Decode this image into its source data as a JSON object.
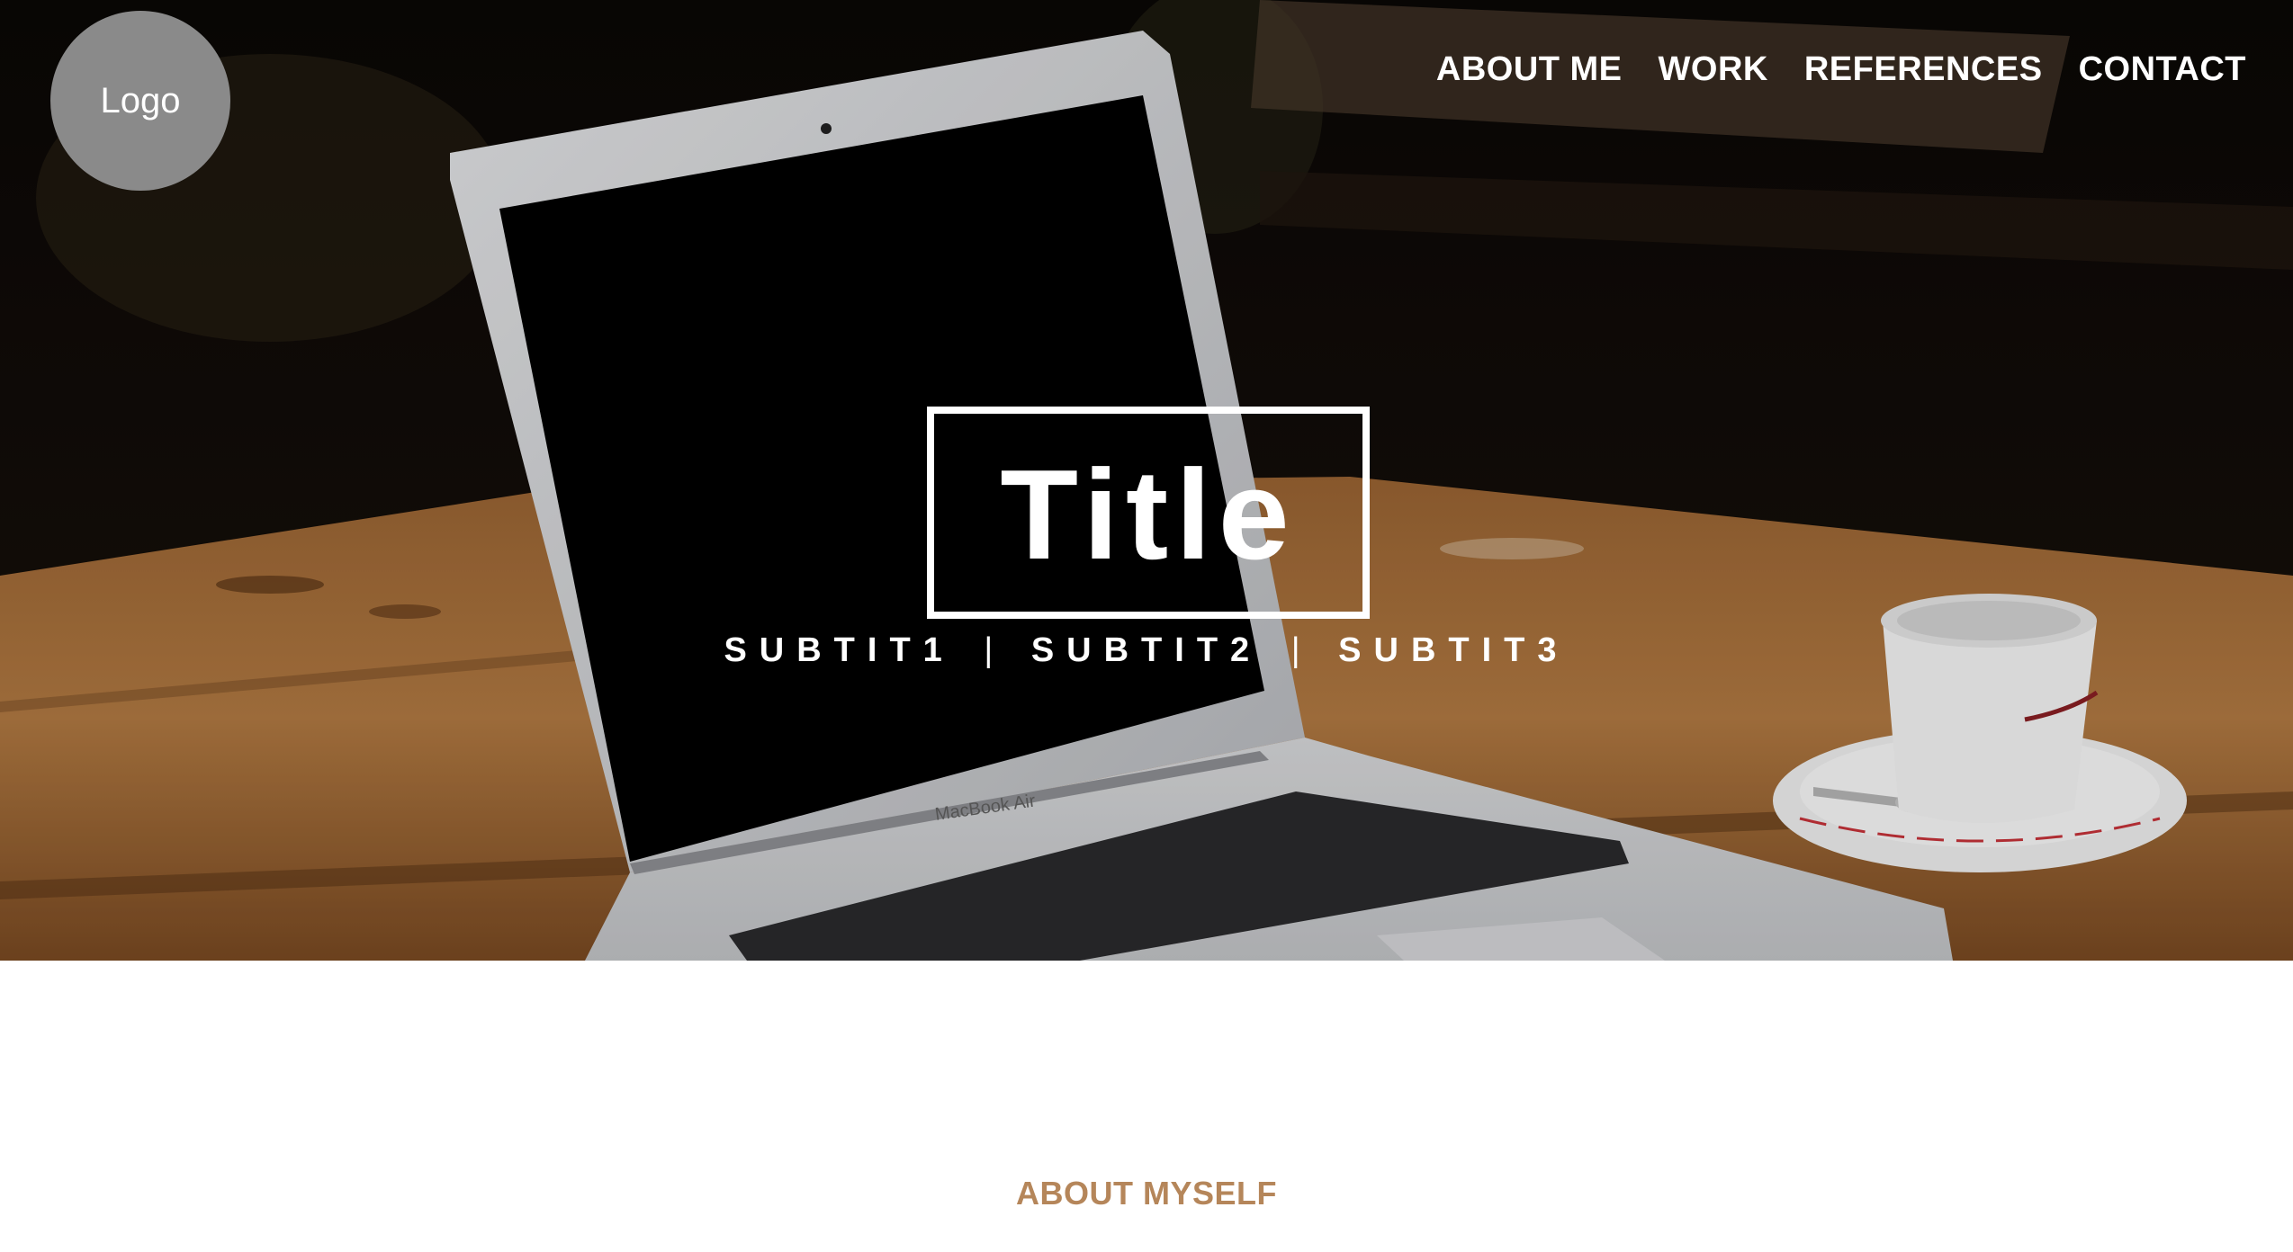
{
  "header": {
    "logo_label": "Logo",
    "nav": [
      {
        "label": "ABOUT ME"
      },
      {
        "label": "WORK"
      },
      {
        "label": "REFERENCES"
      },
      {
        "label": "CONTACT"
      }
    ]
  },
  "hero": {
    "title": "Title",
    "subtitles": [
      "SUBTIT1",
      "SUBTIT2",
      "SUBTIT3"
    ],
    "separator": "|",
    "laptop_brand": "MacBook Air"
  },
  "about": {
    "heading": "ABOUT MYSELF"
  },
  "colors": {
    "accent": "#b5865a",
    "logo_bg": "#8a8a8a",
    "nav_text": "#ffffff"
  }
}
